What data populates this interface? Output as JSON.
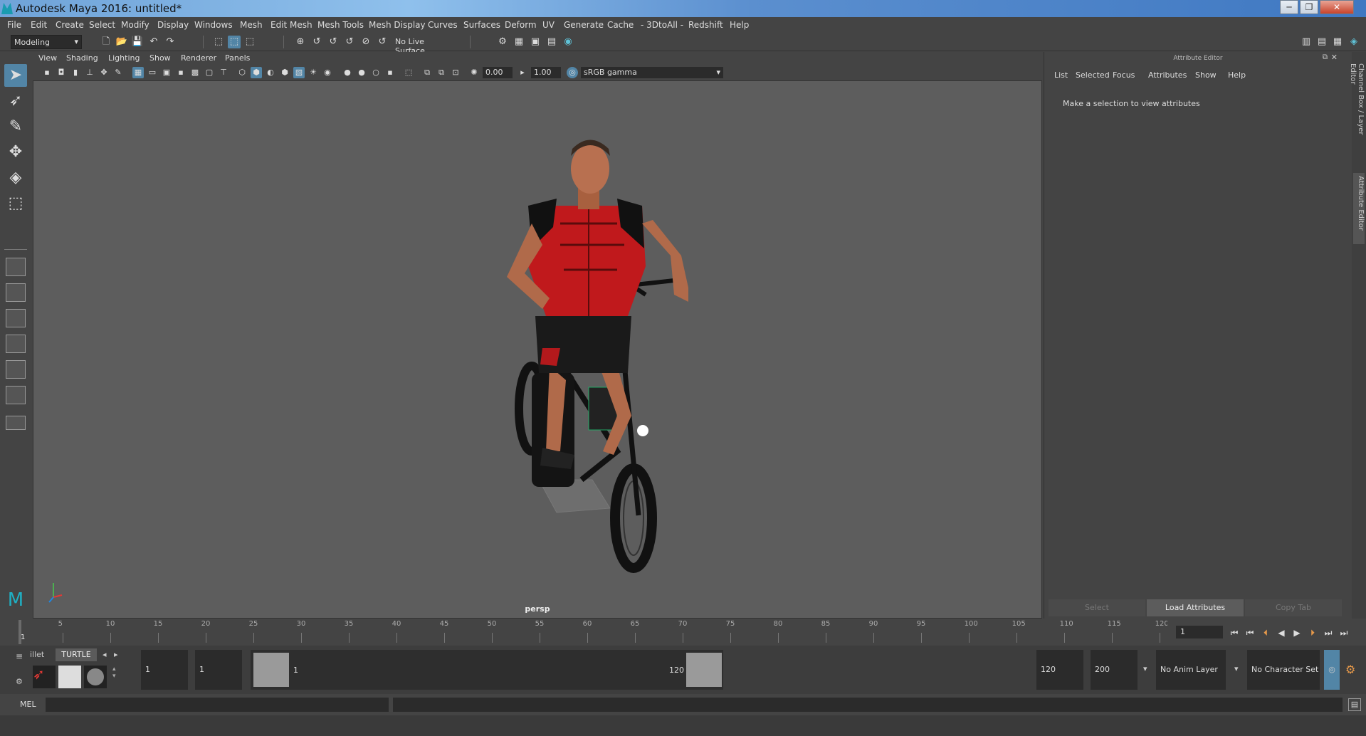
{
  "window": {
    "title": "Autodesk Maya 2016: untitled*",
    "minimize": "─",
    "maximize": "❐",
    "close": "✕"
  },
  "menubar": [
    "File",
    "Edit",
    "Create",
    "Select",
    "Modify",
    "Display",
    "Windows",
    "Mesh",
    "Edit Mesh",
    "Mesh Tools",
    "Mesh Display",
    "Curves",
    "Surfaces",
    "Deform",
    "UV",
    "Generate",
    "Cache",
    "- 3DtoAll -",
    "Redshift",
    "Help"
  ],
  "shelf": {
    "mode": "Modeling",
    "live_surface": "No Live Surface"
  },
  "viewport": {
    "menus": [
      "View",
      "Shading",
      "Lighting",
      "Show",
      "Renderer",
      "Panels"
    ],
    "exposure": "0.00",
    "gamma": "1.00",
    "color_space": "sRGB gamma",
    "camera_label": "persp"
  },
  "attribute_editor": {
    "title": "Attribute Editor",
    "menus": [
      "List",
      "Selected",
      "Focus",
      "Attributes",
      "Show",
      "Help"
    ],
    "message": "Make a selection to view attributes",
    "buttons": {
      "select": "Select",
      "load": "Load Attributes",
      "copy_tab": "Copy Tab"
    },
    "side_tabs": [
      "Channel Box / Layer Editor",
      "Attribute Editor"
    ]
  },
  "timeline": {
    "ticks": [
      "5",
      "10",
      "15",
      "20",
      "25",
      "30",
      "35",
      "40",
      "45",
      "50",
      "55",
      "60",
      "65",
      "70",
      "75",
      "80",
      "85",
      "90",
      "95",
      "100",
      "105",
      "110",
      "115",
      "120"
    ],
    "start_marker": "1",
    "current_frame": "1"
  },
  "range": {
    "shelf_tabs": [
      "illet",
      "TURTLE"
    ],
    "start": "1",
    "playback_start": "1",
    "slider_start": "1",
    "slider_end": "120",
    "playback_end": "120",
    "end": "200",
    "anim_layer": "No Anim Layer",
    "char_set": "No Character Set"
  },
  "cmd": {
    "label": "MEL"
  },
  "colors": {
    "accent": "#5285a6",
    "viewport_bg": "#5d5d5d",
    "panel": "#444444"
  }
}
